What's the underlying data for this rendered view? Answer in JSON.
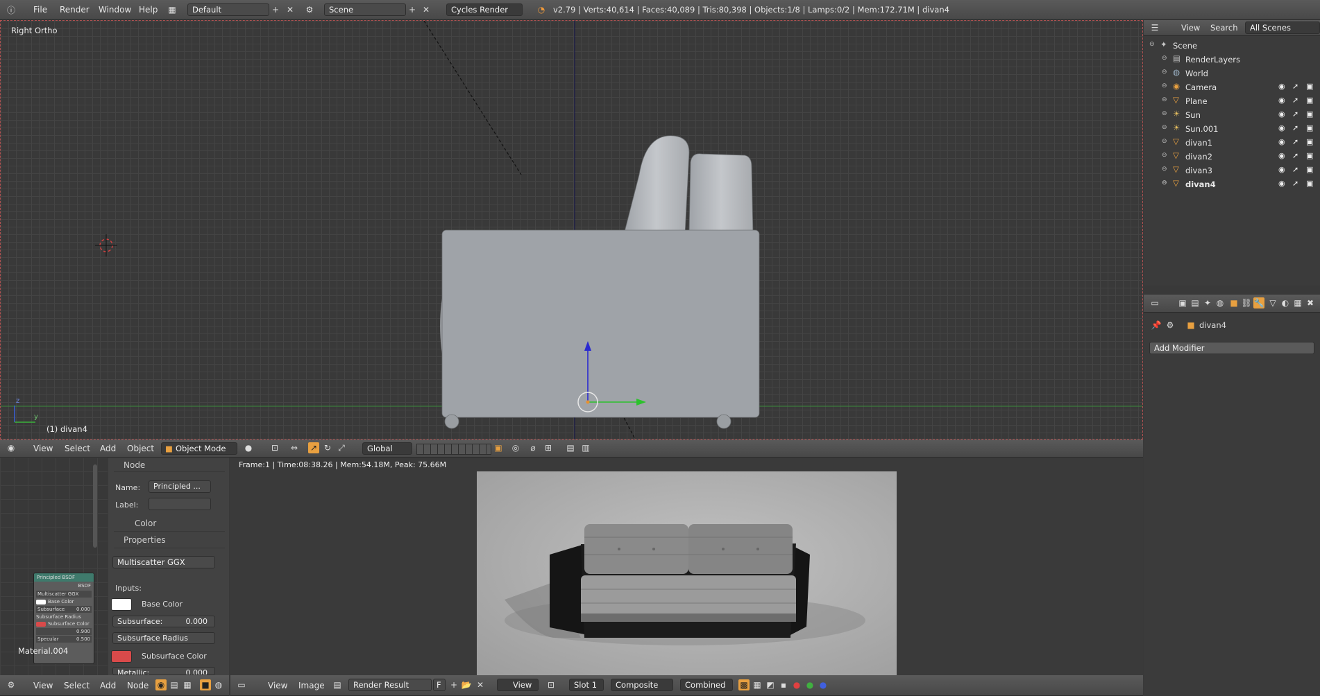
{
  "topbar": {
    "menus": [
      "File",
      "Render",
      "Window",
      "Help"
    ],
    "layout_name": "Default",
    "scene_name": "Scene",
    "render_engine": "Cycles Render",
    "stats": "v2.79 | Verts:40,614 | Faces:40,089 | Tris:80,398 | Objects:1/8 | Lamps:0/2 | Mem:172.71M | divan4"
  },
  "viewport": {
    "view_label": "Right Ortho",
    "object_label": "(1) divan4",
    "axis_z": "z",
    "axis_y": "y",
    "header": {
      "menus": [
        "View",
        "Select",
        "Add",
        "Object"
      ],
      "mode": "Object Mode",
      "orientation": "Global"
    }
  },
  "outliner": {
    "header": {
      "view": "View",
      "search": "Search",
      "filter": "All Scenes"
    },
    "items": [
      {
        "label": "Scene",
        "icon": "scene-icon",
        "indent": 0
      },
      {
        "label": "RenderLayers",
        "icon": "render-layers-icon",
        "indent": 1
      },
      {
        "label": "World",
        "icon": "world-icon",
        "indent": 1
      },
      {
        "label": "Camera",
        "icon": "camera-icon",
        "indent": 1
      },
      {
        "label": "Plane",
        "icon": "mesh-icon",
        "indent": 1
      },
      {
        "label": "Sun",
        "icon": "lamp-icon",
        "indent": 1
      },
      {
        "label": "Sun.001",
        "icon": "lamp-icon",
        "indent": 1
      },
      {
        "label": "divan1",
        "icon": "mesh-icon",
        "indent": 1
      },
      {
        "label": "divan2",
        "icon": "mesh-icon",
        "indent": 1
      },
      {
        "label": "divan3",
        "icon": "mesh-icon",
        "indent": 1
      },
      {
        "label": "divan4",
        "icon": "mesh-icon",
        "indent": 1
      }
    ]
  },
  "properties": {
    "object_name": "divan4",
    "add_modifier": "Add Modifier"
  },
  "node_panel": {
    "node_section": "Node",
    "name_label": "Name:",
    "name_value": "Principled ...",
    "label_label": "Label:",
    "label_value": "",
    "color_section": "Color",
    "properties_section": "Properties",
    "distribution": "Multiscatter GGX",
    "inputs_label": "Inputs:",
    "base_color_label": "Base Color",
    "subsurface_label": "Subsurface:",
    "subsurface_value": "0.000",
    "subsurface_radius": "Subsurface Radius",
    "subsurface_color_label": "Subsurface Color",
    "metallic_label": "Metallic:",
    "metallic_value": "0.000",
    "base_color": "#ffffff",
    "subsurface_color": "#d94a4a"
  },
  "node_editor": {
    "node_title": "Principled BSDF",
    "node_output": "BSDF",
    "node_dist": "Multiscatter GGX",
    "node_base_color": "Base Color",
    "node_subsurface": "Subsurface",
    "node_subsurface_value": "0.000",
    "node_subsurface_radius": "Subsurface Radius",
    "node_subsurface_color": "Subsurface Color",
    "node_metallic_value": "0.900",
    "node_specular": "Specular",
    "node_specular_value": "0.500",
    "material_name": "Material.004",
    "bottom_menus": [
      "View",
      "Select",
      "Add",
      "Node"
    ]
  },
  "image_editor": {
    "info": "Frame:1 | Time:08:38.26 | Mem:54.18M, Peak: 75.66M",
    "bottom_menus": [
      "View",
      "Image"
    ],
    "image_name": "Render Result",
    "f_label": "F",
    "view_label": "View",
    "slot": "Slot 1",
    "layer": "Composite",
    "pass": "Combined"
  }
}
